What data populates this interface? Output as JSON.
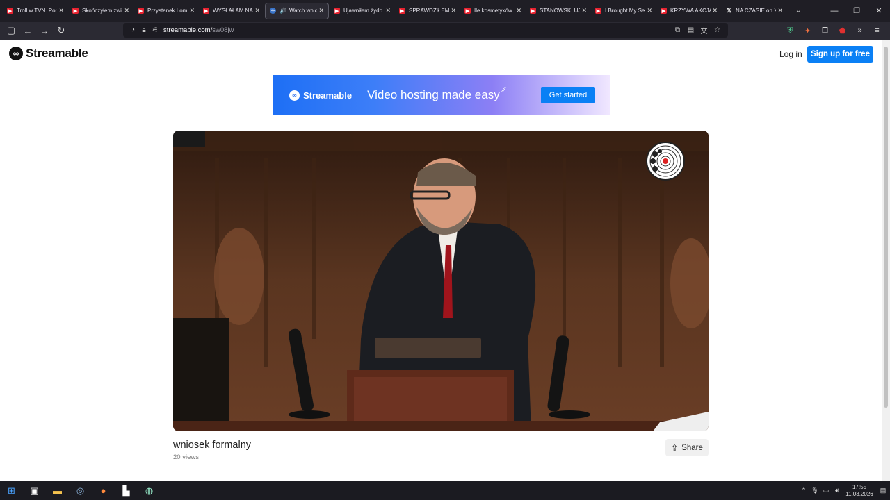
{
  "browser": {
    "tabs": [
      {
        "title": "Troll w TVN. Po:",
        "favicon": "youtube-icon",
        "active": false
      },
      {
        "title": "Skończyłem zwi",
        "favicon": "youtube-icon",
        "active": false
      },
      {
        "title": "Przystanek Lom",
        "favicon": "youtube-icon",
        "active": false
      },
      {
        "title": "WYSŁAŁAM NA",
        "favicon": "youtube-icon",
        "active": false
      },
      {
        "title": "Watch wnic",
        "favicon": "streamable-icon",
        "active": true,
        "audio": true
      },
      {
        "title": "Ujawniłem żydo",
        "favicon": "youtube-icon",
        "active": false
      },
      {
        "title": "SPRAWDZIŁEM",
        "favicon": "youtube-icon",
        "active": false
      },
      {
        "title": "Ile kosmetyków",
        "favicon": "youtube-icon",
        "active": false
      },
      {
        "title": "STANOWSKI UJ",
        "favicon": "youtube-icon",
        "active": false
      },
      {
        "title": "I Brought My Se",
        "favicon": "youtube-icon",
        "active": false
      },
      {
        "title": "KRZYWA AKCJA",
        "favicon": "youtube-icon",
        "active": false
      },
      {
        "title": "NA CZASIE on X",
        "favicon": "x-icon",
        "active": false
      }
    ],
    "url": {
      "domain": "streamable.com/",
      "path": "sw08jw"
    }
  },
  "header": {
    "brand": "Streamable",
    "login": "Log in",
    "signup": "Sign up for free"
  },
  "banner": {
    "brand": "Streamable",
    "tagline": "Video hosting made easy",
    "cta": "Get started"
  },
  "video": {
    "title": "wniosek formalny",
    "views": "20 views",
    "share": "Share"
  },
  "taskbar": {
    "time": "17:55",
    "date": "11.03.2026"
  },
  "colors": {
    "accent": "#0a80f5",
    "tab_bg": "#1f1e25",
    "toolbar_bg": "#2b2a33"
  }
}
